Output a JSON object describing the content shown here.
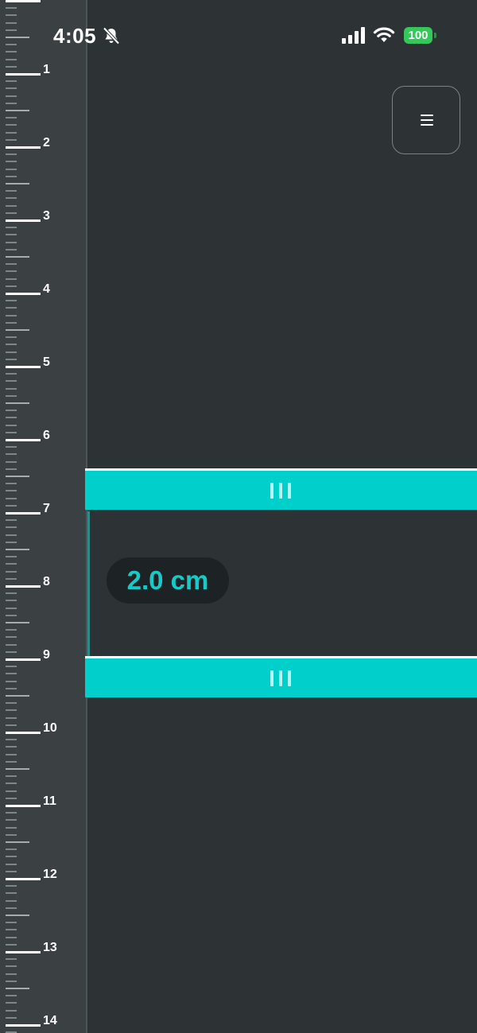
{
  "status_bar": {
    "time": "4:05",
    "battery_level": "100",
    "icons": [
      "bell-slash-icon",
      "cellular-signal-icon",
      "wifi-icon",
      "battery-icon"
    ],
    "battery_color": "#34c759"
  },
  "menu": {
    "icon": "hamburger-menu-icon"
  },
  "ruler": {
    "unit": "cm",
    "labels": [
      "1",
      "2",
      "3",
      "4",
      "5",
      "6",
      "7",
      "8",
      "9",
      "10",
      "11",
      "12",
      "13",
      "14"
    ]
  },
  "measurement": {
    "value_text": "2.0 cm",
    "start_cm": 6.85,
    "end_cm": 8.85,
    "handle_icon": "grip-lines-icon"
  },
  "colors": {
    "background": "#2d3335",
    "ruler_background": "#3b4143",
    "accent": "#00cfcc",
    "measurement_text": "#17cac7"
  }
}
